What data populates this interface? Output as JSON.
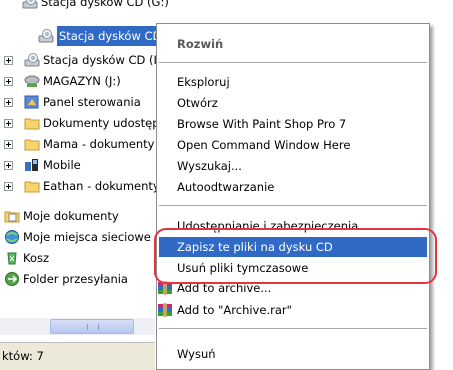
{
  "tree": {
    "items": [
      {
        "label": "Stacja dysków CD (G:)",
        "icon": "cd-drive-icon"
      },
      {
        "label": "Stacja dysków CD (H:)",
        "icon": "cd-drive-icon",
        "selected": true
      },
      {
        "label": "Stacja dysków CD (I:)",
        "icon": "cd-drive-icon"
      },
      {
        "label": "MAGAZYN (J:)",
        "icon": "network-drive-icon"
      },
      {
        "label": "Panel sterowania",
        "icon": "control-panel-icon"
      },
      {
        "label": "Dokumenty udostępnione",
        "icon": "folder-icon"
      },
      {
        "label": "Mama - dokumenty",
        "icon": "folder-icon"
      },
      {
        "label": "Mobile",
        "icon": "mobile-icon"
      },
      {
        "label": "Eathan - dokumenty",
        "icon": "folder-icon"
      },
      {
        "label": "Moje dokumenty",
        "icon": "my-documents-icon"
      },
      {
        "label": "Moje miejsca sieciowe",
        "icon": "network-places-icon"
      },
      {
        "label": "Kosz",
        "icon": "recycle-bin-icon"
      },
      {
        "label": "Folder przesyłania",
        "icon": "transfer-folder-icon"
      }
    ]
  },
  "status": {
    "text": "któw: 7"
  },
  "context_menu": {
    "items": [
      {
        "label": "Rozwiń",
        "bold": true
      },
      {
        "label": "Eksploruj"
      },
      {
        "label": "Otwórz"
      },
      {
        "label": "Browse With Paint Shop Pro 7"
      },
      {
        "label": "Open Command Window Here"
      },
      {
        "label": "Wyszukaj..."
      },
      {
        "label": "Autoodtwarzanie"
      },
      {
        "label": "Udostępnianie i zabezpieczenia..."
      },
      {
        "label": "Zapisz te pliki na dysku CD",
        "highlighted": true
      },
      {
        "label": "Usuń pliki tymczasowe"
      },
      {
        "label": "Add to archive...",
        "icon": "winrar-icon"
      },
      {
        "label": "Add to \"Archive.rar\"",
        "icon": "winrar-icon"
      },
      {
        "label": "Wysuń"
      }
    ]
  },
  "colors": {
    "selection": "#316ac5",
    "annotation": "#e2353e",
    "status_bar": "#ece9d8"
  }
}
